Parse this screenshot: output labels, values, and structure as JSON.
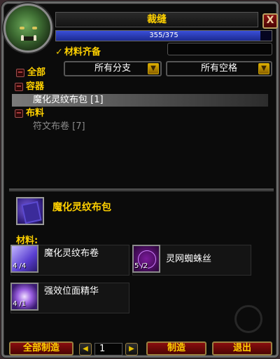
{
  "window": {
    "title": "裁缝",
    "close_label": "X"
  },
  "skill": {
    "current": 355,
    "max": 375,
    "text": "355/375"
  },
  "filters": {
    "have_materials_label": "材料齐备",
    "expand_all_label": "全部",
    "subclass_selected": "所有分支",
    "slot_selected": "所有空格"
  },
  "recipe_list": [
    {
      "type": "header",
      "label": "容器"
    },
    {
      "type": "recipe",
      "label": "魔化灵纹布包 [1]",
      "selected": true,
      "color": "white"
    },
    {
      "type": "header",
      "label": "布料"
    },
    {
      "type": "recipe",
      "label": "符文布卷 [7]",
      "selected": false,
      "color": "gray"
    }
  ],
  "detail": {
    "name": "魔化灵纹布包",
    "icon": "bag-icon",
    "materials_label": "材料:",
    "reagents": [
      {
        "name": "魔化灵纹布卷",
        "count": "4 /4",
        "icon": "cloth-bolt-icon"
      },
      {
        "name": "灵网蜘蛛丝",
        "count": "5 /2",
        "icon": "spider-silk-icon"
      },
      {
        "name": "强效位面精华",
        "count": "4 /1",
        "icon": "planar-essence-icon"
      }
    ]
  },
  "controls": {
    "create_all_label": "全部制造",
    "quantity": "1",
    "create_label": "制造",
    "exit_label": "退出"
  },
  "colors": {
    "gold": "#ffd100",
    "button_red": "#8a0e0e",
    "bar_blue": "#3a4fd8"
  }
}
